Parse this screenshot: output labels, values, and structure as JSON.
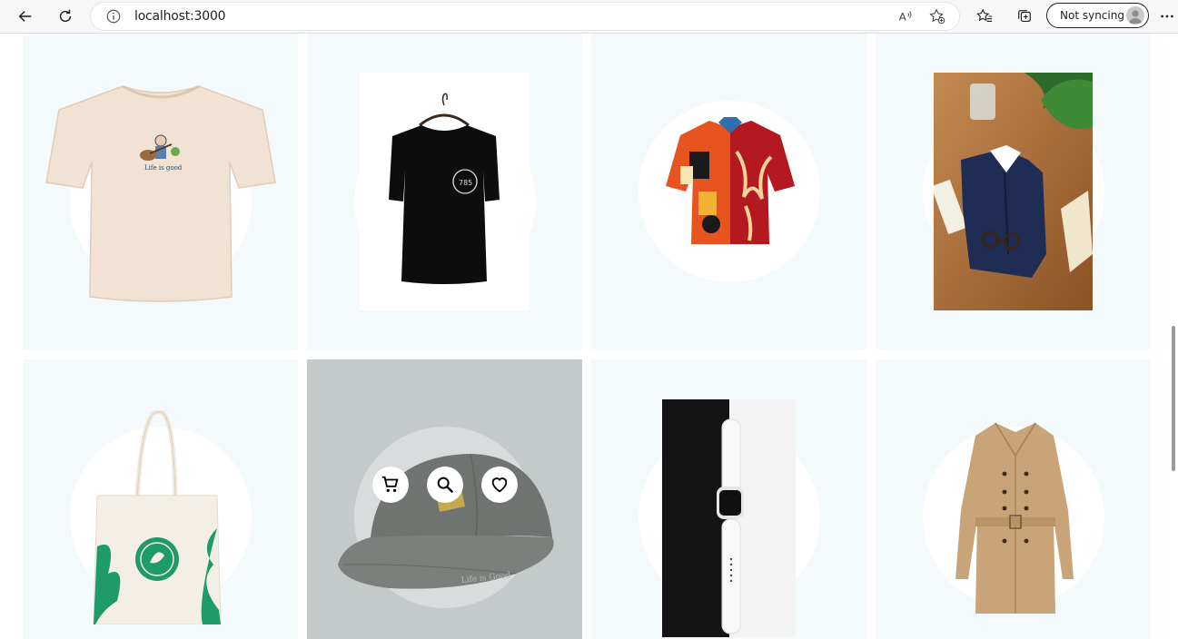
{
  "browser": {
    "url": "localhost:3000",
    "profile_label": "Not syncing",
    "icons": [
      "back-icon",
      "reload-icon",
      "info-icon",
      "read-aloud-icon",
      "add-favorite-icon",
      "favorites-icon",
      "collections-icon",
      "avatar",
      "more-icon"
    ]
  },
  "grid": {
    "products": [
      {
        "name": "cream-tshirt",
        "image": "cream t-shirt with guitar graphic"
      },
      {
        "name": "black-tshirt",
        "image": "black t-shirt on hanger"
      },
      {
        "name": "patterned-shirt",
        "image": "colorful short sleeve shirt"
      },
      {
        "name": "dress-shirt",
        "image": "folded navy dress shirt with glasses"
      },
      {
        "name": "tote-bag",
        "image": "canvas tote bag with green print"
      },
      {
        "name": "cap",
        "image": "grey baseball cap"
      },
      {
        "name": "smartwatch",
        "image": "white smartwatch"
      },
      {
        "name": "trench-coat",
        "image": "beige trench coat"
      }
    ],
    "hover_actions": [
      "cart-icon",
      "search-icon",
      "heart-icon"
    ]
  },
  "colors": {
    "card_bg": "#f4f9fc",
    "hover_overlay": "#c4c9ca",
    "chrome_bg": "#f7f7f7"
  }
}
